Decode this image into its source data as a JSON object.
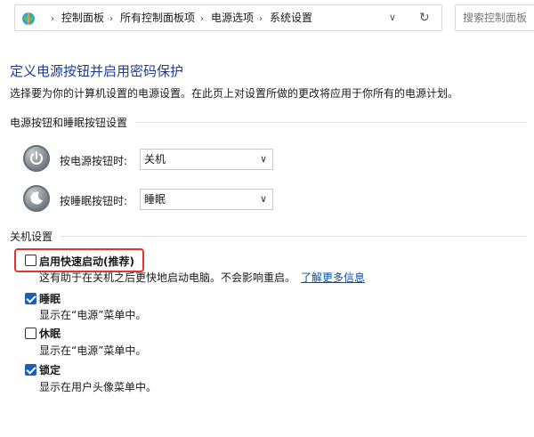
{
  "address_bar": {
    "breadcrumbs": [
      "控制面板",
      "所有控制面板项",
      "电源选项",
      "系统设置"
    ],
    "separator": "›",
    "dropdown_glyph": "∨",
    "refresh_glyph": "↻"
  },
  "search": {
    "placeholder": "搜索控制面板"
  },
  "page": {
    "title": "定义电源按钮并启用密码保护",
    "description": "选择要为你的计算机设置的电源设置。在此页上对设置所做的更改将应用于你所有的电源计划。"
  },
  "power_buttons": {
    "heading": "电源按钮和睡眠按钮设置",
    "power_button": {
      "label": "按电源按钮时:",
      "value": "关机"
    },
    "sleep_button": {
      "label": "按睡眠按钮时:",
      "value": "睡眠"
    },
    "select_arrow": "∨"
  },
  "shutdown": {
    "heading": "关机设置",
    "fast_startup": {
      "label": "启用快速启动(推荐)",
      "checked": false,
      "description": "这有助于在关机之后更快地启动电脑。不会影响重启。",
      "link": "了解更多信息"
    },
    "sleep": {
      "label": "睡眠",
      "checked": true,
      "description": "显示在“电源”菜单中。"
    },
    "hibernate": {
      "label": "休眠",
      "checked": false,
      "description": "显示在“电源”菜单中。"
    },
    "lock": {
      "label": "锁定",
      "checked": true,
      "description": "显示在用户头像菜单中。"
    }
  },
  "colors": {
    "title": "#1e3c94",
    "link": "#0a4ea8",
    "checkbox_checked": "#1a5fb4",
    "highlight": "#e1342e"
  },
  "icons": {
    "address": "control-panel-icon",
    "power": "power-button-icon",
    "sleep": "sleep-button-icon"
  }
}
